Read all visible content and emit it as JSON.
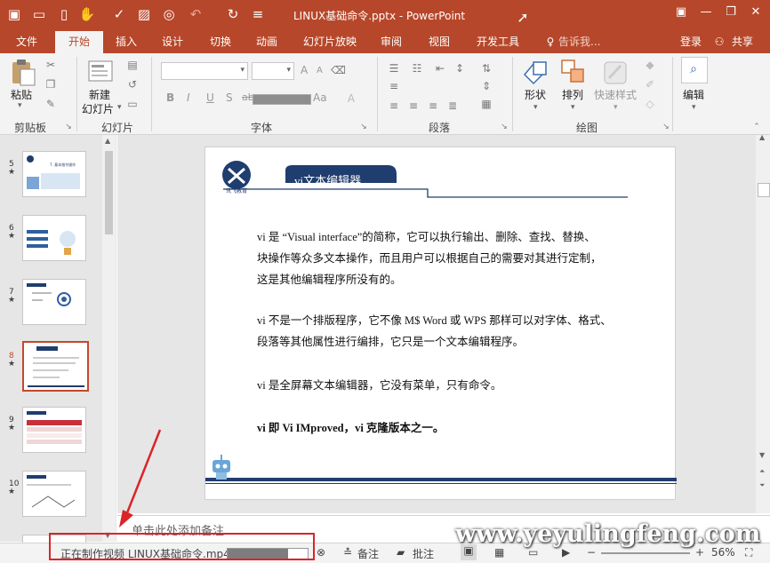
{
  "window": {
    "title": "LINUX基础命令.pptx - PowerPoint"
  },
  "tabs": [
    "文件",
    "开始",
    "插入",
    "设计",
    "切换",
    "动画",
    "幻灯片放映",
    "审阅",
    "视图",
    "开发工具"
  ],
  "active_tab": "开始",
  "tell_me": "告诉我...",
  "account": {
    "login": "登录",
    "share": "共享"
  },
  "ribbon": {
    "clipboard": {
      "label": "剪贴板",
      "paste": "粘贴"
    },
    "slides": {
      "label": "幻灯片",
      "new_slide_1": "新建",
      "new_slide_2": "幻灯片"
    },
    "font": {
      "label": "字体",
      "bold": "B",
      "italic": "I",
      "underline": "U",
      "strike": "S",
      "abc": "abc",
      "aa": "Aa",
      "font_size_a": "A"
    },
    "paragraph": {
      "label": "段落"
    },
    "drawing": {
      "label": "绘图",
      "shape": "形状",
      "arrange": "排列",
      "quick_style": "快速样式"
    },
    "editing": {
      "label": "编辑",
      "edit": "编辑"
    }
  },
  "slide": {
    "header_title": "vi文本编辑器",
    "logo_text": "讯飞教育",
    "paragraphs": [
      {
        "lines": [
          "vi 是 “Visual interface”的简称，它可以执行输出、删除、查找、替换、",
          "块操作等众多文本操作，而且用户可以根据自己的需要对其进行定制，",
          "这是其他编辑程序所没有的。"
        ]
      },
      {
        "lines": [
          "vi 不是一个排版程序，它不像 M$ Word 或 WPS 那样可以对字体、格式、",
          "段落等其他属性进行编排，它只是一个文本编辑程序。"
        ]
      },
      {
        "lines": [
          "vi 是全屏幕文本编辑器，它没有菜单，只有命令。"
        ]
      },
      {
        "lines": [
          "vi 即 Vi IMproved，vi 克隆版本之一。"
        ],
        "bold": true
      }
    ]
  },
  "thumbnails": [
    {
      "title": "7. 基本指令操作"
    },
    {
      "title": ""
    },
    {
      "title": ""
    },
    {
      "title": ""
    },
    {
      "title": ""
    },
    {
      "title": ""
    }
  ],
  "notes_placeholder": "单击此处添加备注",
  "status": {
    "making_video": "正在制作视频 LINUX基础命令.mp4",
    "progress": 0.75,
    "notes": "备注",
    "comments": "批注",
    "zoom": "56%"
  },
  "watermark": "www.yeyulingfeng.com",
  "colors": {
    "accent": "#b7472a",
    "slide_navy": "#1f3d6e",
    "annotation_red": "#d9252a"
  }
}
